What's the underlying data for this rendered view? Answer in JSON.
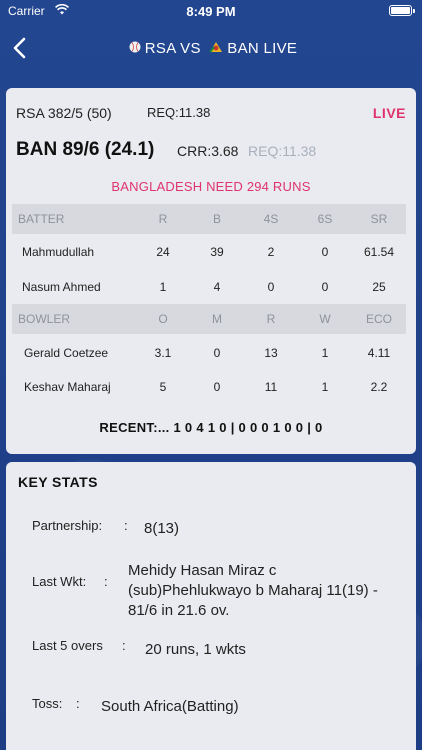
{
  "status_bar": {
    "carrier": "Carrier",
    "time": "8:49 PM"
  },
  "nav": {
    "team1": "RSA",
    "vs": "VS",
    "team2": "BAN",
    "live": "LIVE",
    "team1_icon": "cricket-ball-icon",
    "team2_icon": "bangladesh-flag-icon"
  },
  "score": {
    "rsa_score": "RSA 382/5 (50)",
    "rsa_req": "REQ:11.38",
    "live_label": "LIVE",
    "ban_score": "BAN 89/6 (24.1)",
    "crr": "CRR:3.68",
    "ban_req": "REQ:11.38",
    "need_text": "BANGLADESH NEED 294 RUNS"
  },
  "batting": {
    "headers": [
      "BATTER",
      "R",
      "B",
      "4S",
      "6S",
      "SR"
    ],
    "rows": [
      [
        "Mahmudullah",
        "24",
        "39",
        "2",
        "0",
        "61.54"
      ],
      [
        "Nasum Ahmed",
        "1",
        "4",
        "0",
        "0",
        "25"
      ]
    ]
  },
  "bowling": {
    "headers": [
      "BOWLER",
      "O",
      "M",
      "R",
      "W",
      "ECO"
    ],
    "rows": [
      [
        "Gerald Coetzee",
        "3.1",
        "0",
        "13",
        "1",
        "4.11"
      ],
      [
        "Keshav Maharaj",
        "5",
        "0",
        "11",
        "1",
        "2.2"
      ]
    ]
  },
  "recent": "RECENT:... 1 0 4 1 0 | 0 0 0 1 0 0 | 0",
  "key_stats": {
    "title": "KEY STATS",
    "partnership_label": "Partnership:",
    "partnership_value": "8(13)",
    "last_wkt_label": "Last Wkt:",
    "last_wkt_value": "Mehidy Hasan Miraz c (sub)Phehlukwayo b Maharaj 11(19) - 81/6 in 21.6 ov.",
    "last5_label": "Last 5 overs",
    "last5_value": "20 runs, 1 wkts",
    "toss_label": "Toss:",
    "toss_value": "South Africa(Batting)",
    "colon": ":"
  }
}
